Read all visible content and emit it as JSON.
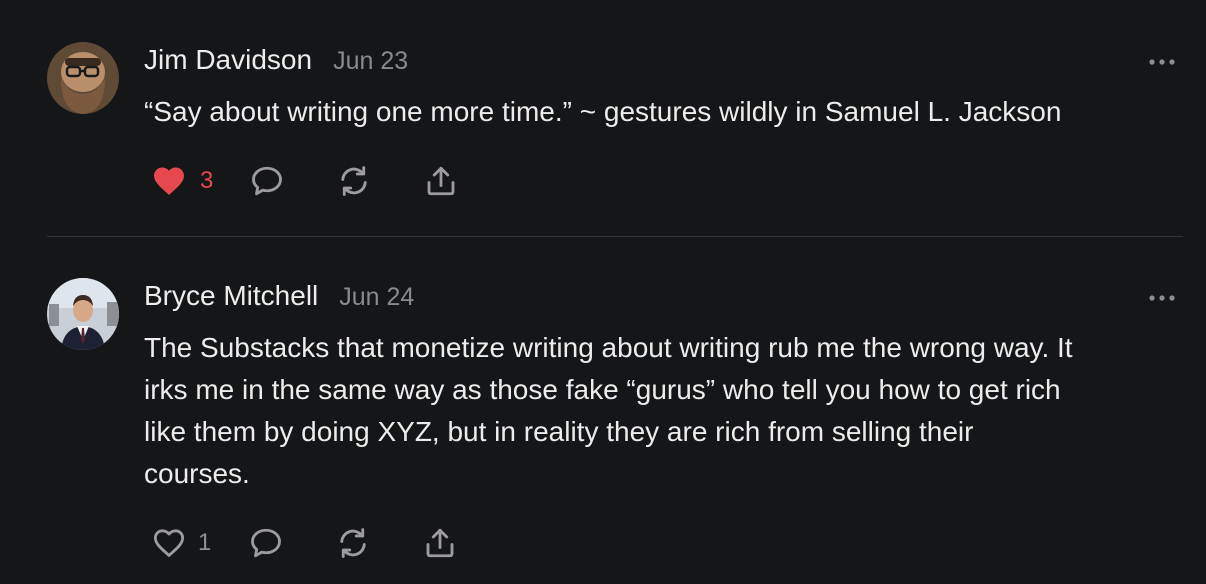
{
  "comments": [
    {
      "author": "Jim Davidson",
      "date": "Jun 23",
      "text": "“Say about writing one more time.” ~ gestures wildly in Samuel L. Jackson",
      "likes": "3",
      "liked": true
    },
    {
      "author": "Bryce Mitchell",
      "date": "Jun 24",
      "text_lines": [
        "The Substacks that monetize writing about writing rub me the wrong way. It",
        "irks me in the same way as those fake “gurus” who tell you how to get rich",
        "like them by doing XYZ, but in reality they are rich from selling their",
        "courses."
      ],
      "likes": "1",
      "liked": false
    }
  ],
  "colors": {
    "background": "#151618",
    "liked_heart": "#e5484d",
    "icon_gray": "#9b9ba0",
    "date_gray": "#8a8a8c"
  },
  "icons": [
    "heart-icon",
    "comment-bubble-icon",
    "restack-icon",
    "share-icon",
    "more-dots-icon"
  ]
}
